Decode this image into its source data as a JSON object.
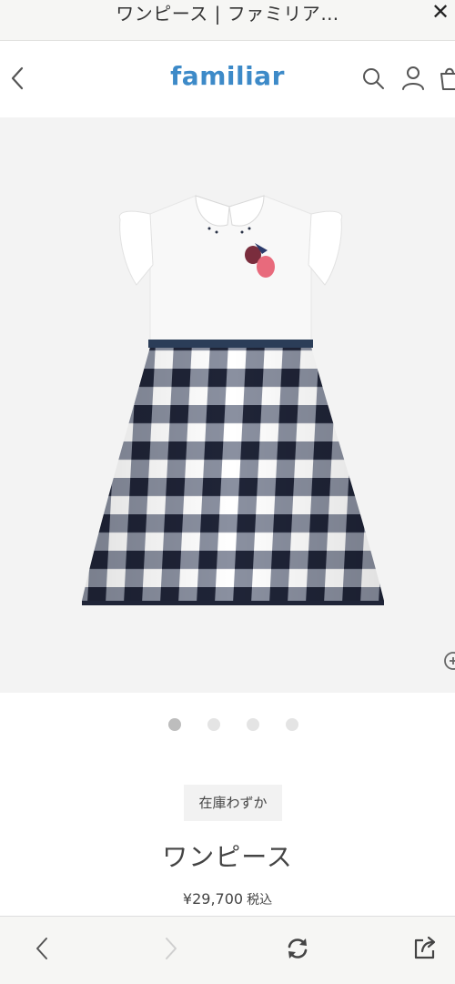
{
  "browser": {
    "page_title": "ワンピース | ファミリア…",
    "close_label": "✕"
  },
  "header": {
    "logo_text": "familiar",
    "icons": [
      "back-icon",
      "search-icon",
      "user-icon",
      "cart-icon"
    ],
    "brand_color": "#3d8ac8"
  },
  "gallery": {
    "image_count": 4,
    "active_index": 0
  },
  "product": {
    "stock_badge": "在庫わずか",
    "name": "ワンピース",
    "price": "¥29,700",
    "tax_label": "税込"
  },
  "toolbar": {
    "icons": [
      "back-arrow-icon",
      "forward-arrow-icon",
      "reload-icon",
      "share-icon"
    ]
  }
}
